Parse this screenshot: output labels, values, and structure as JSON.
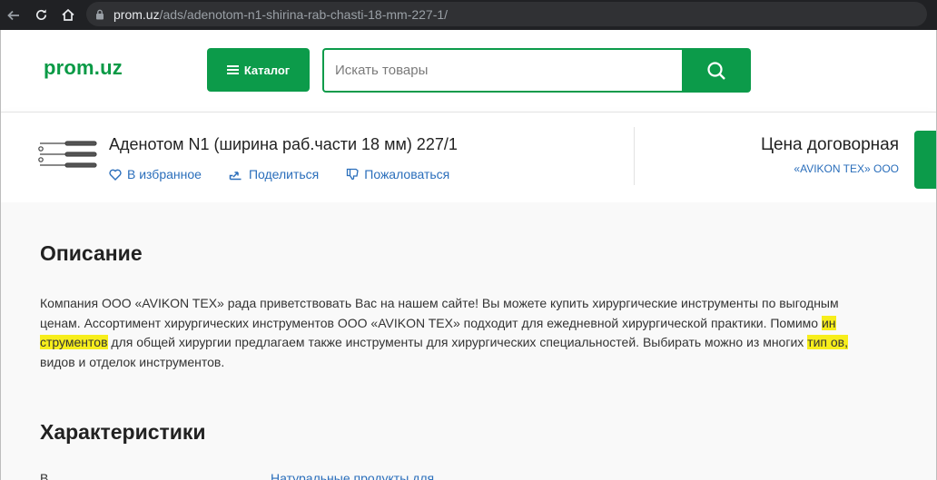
{
  "browser": {
    "url_host": "prom.uz",
    "url_path": "/ads/adenotom-n1-shirina-rab-chasti-18-mm-227-1/"
  },
  "header": {
    "logo": "prom.uz",
    "catalog_label": "Каталог",
    "search_placeholder": "Искать товары"
  },
  "product": {
    "title": "Аденотом N1 (ширина раб.части 18 мм) 227/1",
    "actions": {
      "favorite": "В избранное",
      "share": "Поделиться",
      "report": "Пожаловаться"
    },
    "price": "Цена договорная",
    "seller": "«AVIKON TEX» ООО"
  },
  "description": {
    "heading": "Описание",
    "p1": "Компания ООО «AVIKON TEX» рада приветствовать Вас на нашем сайте! Вы можете купить хирургические инструменты по выгодным ценам. Ассортимент хирургических инструментов ООО «AVIKON TEX» подходит для ежедневной хирургической практики. Помимо ",
    "hl1": "ин струментов",
    "p2": " для общей хирургии предлагаем также инструменты для хирургических специальностей. Выбирать можно из многих ",
    "hl2": "тип ов,",
    "p3": " видов и отделок инструментов."
  },
  "characteristics": {
    "heading": "Характеристики",
    "row_label": "В",
    "row_value": "Натуральные продукты для"
  },
  "colors": {
    "brand_green": "#0c9b4a",
    "link_blue": "#2a6ebb",
    "highlight": "#f7ee1c"
  }
}
